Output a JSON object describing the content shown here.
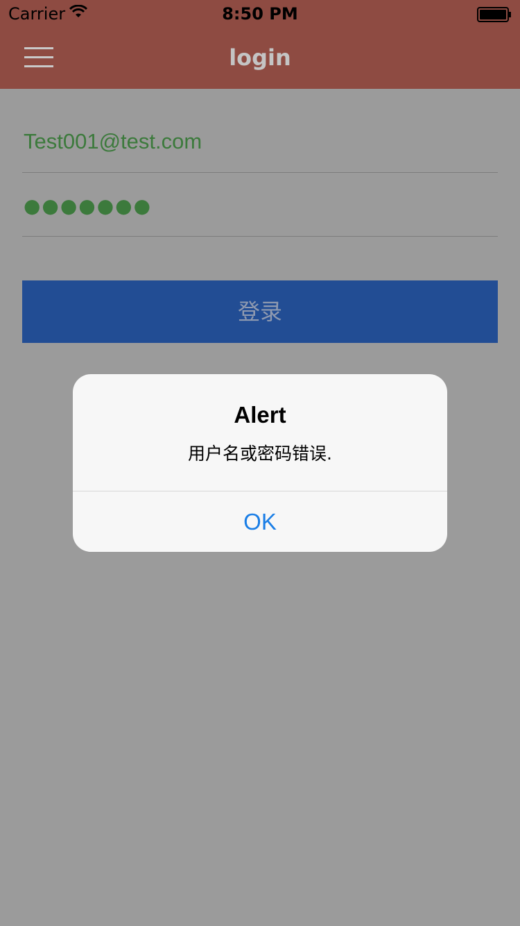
{
  "status_bar": {
    "carrier": "Carrier",
    "time": "8:50 PM"
  },
  "nav": {
    "title": "login"
  },
  "form": {
    "email_value": "Test001@test.com",
    "password_value": "●●●●●●●",
    "login_label": "登录"
  },
  "alert": {
    "title": "Alert",
    "message": "用户名或密码错误.",
    "ok_label": "OK"
  },
  "colors": {
    "nav_background": "#8e4b42",
    "overlay_background": "#9b9b9b",
    "button_background": "#224d94",
    "input_text": "#3c7a3c",
    "alert_action": "#1a7ee6"
  },
  "icons": [
    "wifi-icon",
    "battery-icon",
    "menu-icon"
  ]
}
